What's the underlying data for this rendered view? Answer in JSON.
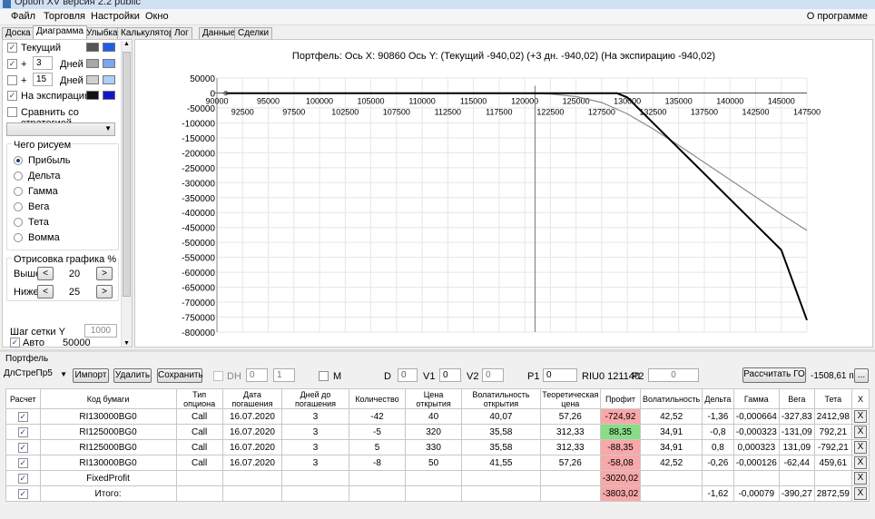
{
  "window": {
    "title": "Option XV версия 2.2 public"
  },
  "menu": {
    "items": [
      "Файл",
      "Торговля",
      "Настройки",
      "Окно"
    ],
    "about": "О программе"
  },
  "tabs": [
    "Доска",
    "Диаграмма",
    "Улыбка",
    "Калькулятор",
    "Лог",
    "Данные",
    "Сделки"
  ],
  "active_tab": "Диаграмма",
  "left": {
    "current_label": "Текущий",
    "plus1": "+",
    "days1_value": "3",
    "days_label1": "Дней",
    "plus2": "+",
    "days2_value": "15",
    "days_label2": "Дней",
    "expiry_label": "На экспирацию",
    "compare_label": "Сравнить со стратегией",
    "what_title": "Чего рисуем",
    "radios": [
      "Прибыль",
      "Дельта",
      "Гамма",
      "Вега",
      "Тета",
      "Вомма"
    ],
    "render_title": "Отрисовка графика %",
    "above_label": "Выше",
    "above_value": "20",
    "below_label": "Ниже",
    "below_value": "25",
    "grid_step_label": "Шаг сетки Y",
    "grid_step_value": "1000",
    "auto_label": "Авто",
    "auto_value": "50000"
  },
  "colors": {
    "current_swatch": [
      "#555555",
      "#1f5fe8"
    ],
    "days1_swatch": [
      "#a8a8a8",
      "#7aa6f2"
    ],
    "days2_swatch": [
      "#d0d0d0",
      "#aad0f8"
    ],
    "expiry_swatch": [
      "#111111",
      "#1515c8"
    ],
    "profit_neg": "#f8a8a8",
    "profit_pos": "#88dd88"
  },
  "chart": {
    "header": "Портфель: Ось X:  90860 Ось Y:  (Текущий -940,02)  (+3 дн. -940,02)  (На экспирацию -940,02)"
  },
  "chart_data": {
    "type": "line",
    "title": "Портфель: Ось X:  90860 Ось Y:  (Текущий -940,02)  (+3 дн. -940,02)  (На экспирацию -940,02)",
    "xlim": [
      90000,
      147500
    ],
    "ylim": [
      -800000,
      50000
    ],
    "x_ticks_top": [
      "90000",
      "95000",
      "100000",
      "105000",
      "110000",
      "115000",
      "120000",
      "125000",
      "130000",
      "135000",
      "140000",
      "145000"
    ],
    "x_ticks_bottom": [
      "92500",
      "97500",
      "102500",
      "107500",
      "112500",
      "117500",
      "122500",
      "127500",
      "132500",
      "137500",
      "142500",
      "147500"
    ],
    "y_ticks": [
      "50000",
      "0",
      "-50000",
      "-100000",
      "-150000",
      "-200000",
      "-250000",
      "-300000",
      "-350000",
      "-400000",
      "-450000",
      "-500000",
      "-550000",
      "-600000",
      "-650000",
      "-700000",
      "-750000",
      "-800000"
    ],
    "cursor_x": 121000,
    "grid": true,
    "series": [
      {
        "points": [
          [
            90860,
            -940
          ],
          [
            120000,
            -940
          ],
          [
            122500,
            -3500
          ],
          [
            125000,
            -12000
          ],
          [
            127500,
            -32000
          ],
          [
            130000,
            -70000
          ],
          [
            132500,
            -120000
          ],
          [
            135000,
            -175000
          ],
          [
            140000,
            -290000
          ],
          [
            145000,
            -405000
          ],
          [
            147500,
            -460000
          ]
        ]
      },
      {
        "points": [
          [
            90860,
            -940
          ],
          [
            129000,
            -940
          ],
          [
            130000,
            -15000
          ],
          [
            132500,
            -100000
          ],
          [
            135000,
            -185000
          ],
          [
            140000,
            -355000
          ],
          [
            145000,
            -525000
          ],
          [
            147500,
            -760000
          ]
        ]
      }
    ]
  },
  "toolbar": {
    "strategy": "ДлСтреПр5",
    "import": "Импорт",
    "delete": "Удалить",
    "save": "Сохранить",
    "dh": "DH",
    "dh_val1": "0",
    "dh_val2": "1",
    "m": "M",
    "d_label": "D",
    "d_value": "0",
    "v1_label": "V1",
    "v1_value": "0",
    "v2_label": "V2",
    "v2_value": "0",
    "p1_label": "P1",
    "p1_value": "0",
    "riu": "RIU0 121140",
    "p2_label": "P2",
    "p2_value": "0",
    "calc_go": "Рассчитать ГО",
    "go_value": "-1508,61 п.",
    "dots": "..."
  },
  "portfolio_label": "Портфель",
  "table": {
    "headers": [
      "Расчет",
      "Код бумаги",
      "Тип опциона",
      "Дата погашения",
      "Дней до погашения",
      "Количество",
      "Цена открытия",
      "Волатильность открытия",
      "Теоретическая цена",
      "Профит",
      "Волатильность",
      "Дельта",
      "Гамма",
      "Вега",
      "Тета",
      "X"
    ],
    "rows": [
      {
        "code": "RI130000BG0",
        "type": "Call",
        "date": "16.07.2020",
        "days": "3",
        "qty": "-42",
        "price": "40",
        "vol_open": "40,07",
        "theo": "57,26",
        "profit": "-724,92",
        "profit_sign": "neg",
        "vol": "42,52",
        "delta": "-1,36",
        "gamma": "-0,000664",
        "vega": "-327,83",
        "theta": "2412,98",
        "x": "X"
      },
      {
        "code": "RI125000BG0",
        "type": "Call",
        "date": "16.07.2020",
        "days": "3",
        "qty": "-5",
        "price": "320",
        "vol_open": "35,58",
        "theo": "312,33",
        "profit": "88,35",
        "profit_sign": "pos",
        "vol": "34,91",
        "delta": "-0,8",
        "gamma": "-0,000323",
        "vega": "-131,09",
        "theta": "792,21",
        "x": "X"
      },
      {
        "code": "RI125000BG0",
        "type": "Call",
        "date": "16.07.2020",
        "days": "3",
        "qty": "5",
        "price": "330",
        "vol_open": "35,58",
        "theo": "312,33",
        "profit": "-88,35",
        "profit_sign": "neg",
        "vol": "34,91",
        "delta": "0,8",
        "gamma": "0,000323",
        "vega": "131,09",
        "theta": "-792,21",
        "x": "X"
      },
      {
        "code": "RI130000BG0",
        "type": "Call",
        "date": "16.07.2020",
        "days": "3",
        "qty": "-8",
        "price": "50",
        "vol_open": "41,55",
        "theo": "57,26",
        "profit": "-58,08",
        "profit_sign": "neg",
        "vol": "42,52",
        "delta": "-0,26",
        "gamma": "-0,000126",
        "vega": "-62,44",
        "theta": "459,61",
        "x": "X"
      },
      {
        "code": "FixedProfit",
        "type": "",
        "date": "",
        "days": "",
        "qty": "",
        "price": "",
        "vol_open": "",
        "theo": "",
        "profit": "-3020,02",
        "profit_sign": "neg",
        "vol": "",
        "delta": "",
        "gamma": "",
        "vega": "",
        "theta": "",
        "x": "X"
      },
      {
        "code": "Итого:",
        "type": "",
        "date": "",
        "days": "",
        "qty": "",
        "price": "",
        "vol_open": "",
        "theo": "",
        "profit": "-3803,02",
        "profit_sign": "neg",
        "vol": "",
        "delta": "-1,62",
        "gamma": "-0,00079",
        "vega": "-390,27",
        "theta": "2872,59",
        "x": "X"
      }
    ]
  }
}
